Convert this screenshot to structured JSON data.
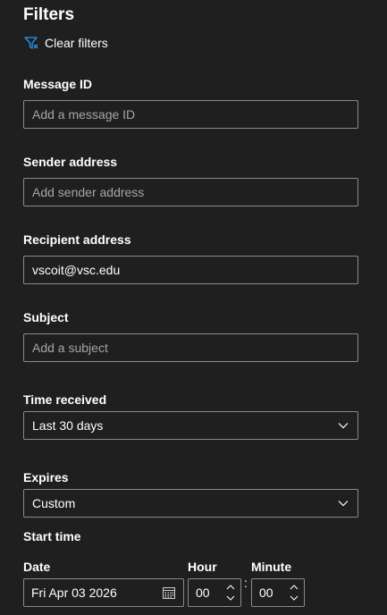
{
  "panel": {
    "title": "Filters",
    "clear_filters": "Clear filters",
    "accent_color": "#2899f5"
  },
  "fields": {
    "message_id": {
      "label": "Message ID",
      "placeholder": "Add a message ID"
    },
    "sender": {
      "label": "Sender address",
      "placeholder": "Add sender address"
    },
    "recipient": {
      "label": "Recipient address",
      "value": "vscoit@vsc.edu"
    },
    "subject": {
      "label": "Subject",
      "placeholder": "Add a subject"
    },
    "time_received": {
      "label": "Time received",
      "value": "Last 30 days"
    },
    "expires": {
      "label": "Expires",
      "value": "Custom"
    }
  },
  "start_time": {
    "label": "Start time",
    "date_label": "Date",
    "date_value": "Fri Apr 03 2026",
    "hour_label": "Hour",
    "hour_value": "00",
    "minute_label": "Minute",
    "minute_value": "00",
    "separator": ":"
  }
}
